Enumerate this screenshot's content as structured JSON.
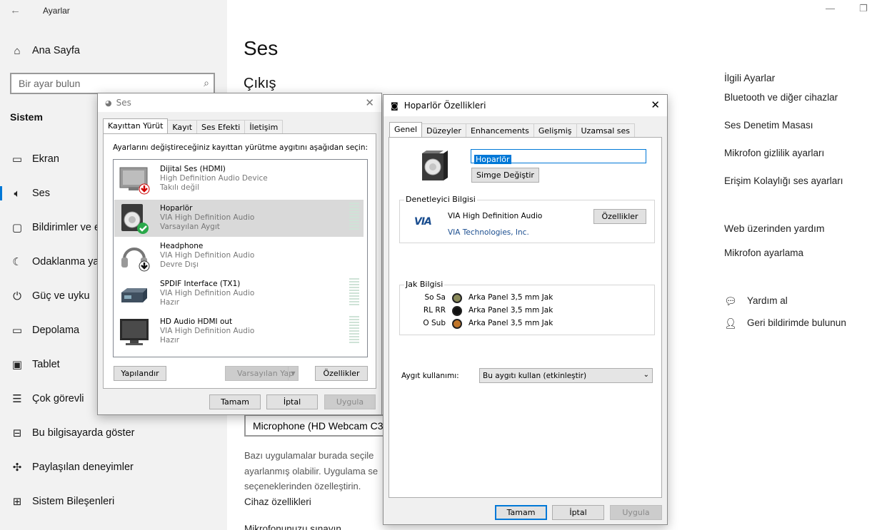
{
  "settings": {
    "window_title": "Ayarlar",
    "home": "Ana Sayfa",
    "search_placeholder": "Bir ayar bulun",
    "section": "Sistem",
    "nav": [
      {
        "label": "Ekran",
        "icon": "monitor-icon"
      },
      {
        "label": "Ses",
        "icon": "speaker-icon"
      },
      {
        "label": "Bildirimler ve e",
        "icon": "notification-icon"
      },
      {
        "label": "Odaklanma ya",
        "icon": "moon-icon"
      },
      {
        "label": "Güç ve uyku",
        "icon": "power-icon"
      },
      {
        "label": "Depolama",
        "icon": "storage-icon"
      },
      {
        "label": "Tablet",
        "icon": "tablet-icon"
      },
      {
        "label": "Çok görevli",
        "icon": "multitask-icon"
      },
      {
        "label": "Bu bilgisayarda göster",
        "icon": "project-icon"
      },
      {
        "label": "Paylaşılan deneyimler",
        "icon": "share-icon"
      },
      {
        "label": "Sistem Bileşenleri",
        "icon": "components-icon"
      }
    ],
    "page_title": "Ses",
    "page_subtitle": "Çıkış",
    "mic_select": "Microphone (HD Webcam C3",
    "body_lines": [
      "Bazı uygulamalar burada seçile",
      "ayarlanmış olabilir. Uygulama se",
      "seçeneklerinden özelleştirin."
    ],
    "device_props": "Cihaz özellikleri",
    "test_mic": "Mikrofonunuzu sınayın",
    "related_title": "İlgili Ayarlar",
    "related_links": [
      "Bluetooth ve diğer cihazlar",
      "Ses Denetim Masası",
      "Mikrofon gizlilik ayarları",
      "Erişim Kolaylığı ses ayarları"
    ],
    "web_help_title": "Web üzerinden yardım",
    "web_help_links": [
      "Mikrofon ayarlama"
    ],
    "help": "Yardım al",
    "feedback": "Geri bildirimde bulunun"
  },
  "sound_dialog": {
    "title": "Ses",
    "tabs": [
      "Kayıttan Yürüt",
      "Kayıt",
      "Ses Efekti",
      "İletişim"
    ],
    "instruction": "Ayarlarını değiştireceğiniz kayıttan yürütme aygıtını aşağıdan seçin:",
    "devices": [
      {
        "name": "Dijital Ses (HDMI)",
        "driver": "High Definition Audio Device",
        "status": "Takılı değil"
      },
      {
        "name": "Hoparlör",
        "driver": "VIA High Definition Audio",
        "status": "Varsayılan Aygıt"
      },
      {
        "name": "Headphone",
        "driver": "VIA High Definition Audio",
        "status": "Devre Dışı"
      },
      {
        "name": "SPDIF Interface (TX1)",
        "driver": "VIA High Definition Audio",
        "status": "Hazır"
      },
      {
        "name": "HD Audio HDMI out",
        "driver": "VIA High Definition Audio",
        "status": "Hazır"
      }
    ],
    "configure": "Yapılandır",
    "set_default": "Varsayılan Yap",
    "properties": "Özellikler",
    "ok": "Tamam",
    "cancel": "İptal",
    "apply": "Uygula"
  },
  "speaker_dialog": {
    "title": "Hoparlör Özellikleri",
    "tabs": [
      "Genel",
      "Düzeyler",
      "Enhancements",
      "Gelişmiş",
      "Uzamsal ses"
    ],
    "name_value": "Hoparlör",
    "change_icon": "Simge Değiştir",
    "controller_group": "Denetleyici Bilgisi",
    "controller_name": "VIA High Definition Audio",
    "controller_vendor": "VIA Technologies, Inc.",
    "controller_props": "Özellikler",
    "via_logo": "VIA",
    "jack_group": "Jak Bilgisi",
    "jacks": [
      {
        "channel": "So Sa",
        "location": "Arka Panel 3,5 mm Jak",
        "color": "#8a8a5a"
      },
      {
        "channel": "RL RR",
        "location": "Arka Panel 3,5 mm Jak",
        "color": "#111111"
      },
      {
        "channel": "O Sub",
        "location": "Arka Panel 3,5 mm Jak",
        "color": "#c0762a"
      }
    ],
    "usage_label": "Aygıt kullanımı:",
    "usage_value": "Bu aygıtı kullan (etkinleştir)",
    "ok": "Tamam",
    "cancel": "İptal",
    "apply": "Uygula"
  }
}
